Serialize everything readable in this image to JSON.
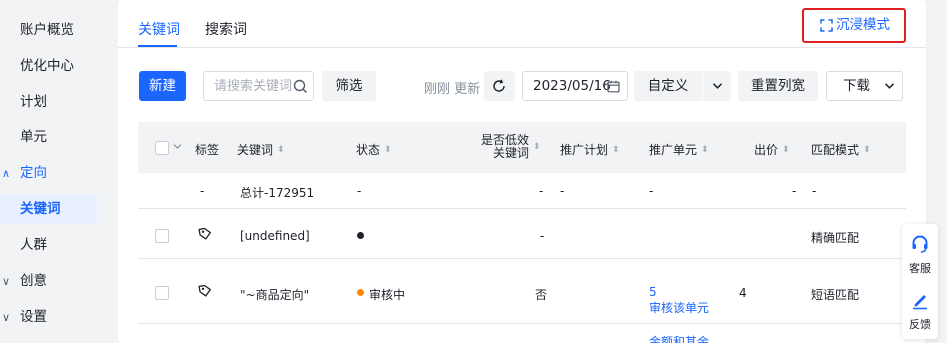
{
  "sidebar": {
    "items": [
      {
        "label": "账户概览"
      },
      {
        "label": "优化中心"
      },
      {
        "label": "计划"
      },
      {
        "label": "单元"
      },
      {
        "label": "定向",
        "caret": "∧"
      },
      {
        "label": "关键词"
      },
      {
        "label": "人群"
      },
      {
        "label": "创意",
        "caret": "∨"
      },
      {
        "label": "设置",
        "caret": "∨"
      }
    ]
  },
  "tabs": [
    {
      "label": "关键词",
      "active": true
    },
    {
      "label": "搜索词",
      "active": false
    }
  ],
  "immersive_label": "沉浸模式",
  "toolbar": {
    "new_label": "新建",
    "search_placeholder": "请搜索关键词",
    "filter_label": "筛选",
    "refresh_text": "刚刚 更新",
    "date_value": "2023/05/16",
    "custom_label": "自定义",
    "reset_columns_label": "重置列宽",
    "download_label": "下载"
  },
  "table": {
    "headers": {
      "tag": "标签",
      "keyword": "关键词",
      "status": "状态",
      "low_effect_line1": "是否低效",
      "low_effect_line2": "关键词",
      "plan": "推广计划",
      "unit": "推广单元",
      "bid": "出价",
      "match": "匹配模式"
    },
    "total_row": {
      "tag": "-",
      "keyword": "总计-172951",
      "status": "-",
      "low_effect": "-",
      "plan": "-",
      "unit": "-",
      "bid": "-",
      "match": "-"
    },
    "rows": [
      {
        "keyword": "[undefined]",
        "status": "",
        "low_effect": "-",
        "unit_line1": "",
        "unit_line2": "",
        "bid": "",
        "match": "精确匹配"
      },
      {
        "keyword": "\"~商品定向\"",
        "status": "审核中",
        "low_effect": "否",
        "unit_line1": "5",
        "unit_line2": "审核该单元",
        "bid": "4",
        "match": "短语匹配"
      }
    ],
    "partial_row_text": "金额和其余"
  },
  "float_panel": {
    "service_label": "客服",
    "feedback_label": "反馈"
  },
  "colors": {
    "accent": "#1a66ff",
    "status_pending": "#ff8a00",
    "status_unknown": "#1d2129",
    "highlight_border": "#e02020"
  },
  "icons": {
    "immersive": "expand-icon",
    "search": "search-icon",
    "refresh": "refresh-icon",
    "date": "calendar-icon",
    "dropdown": "chevron-down-icon",
    "tag": "tag-icon",
    "service": "headset-icon",
    "feedback": "edit-icon"
  }
}
